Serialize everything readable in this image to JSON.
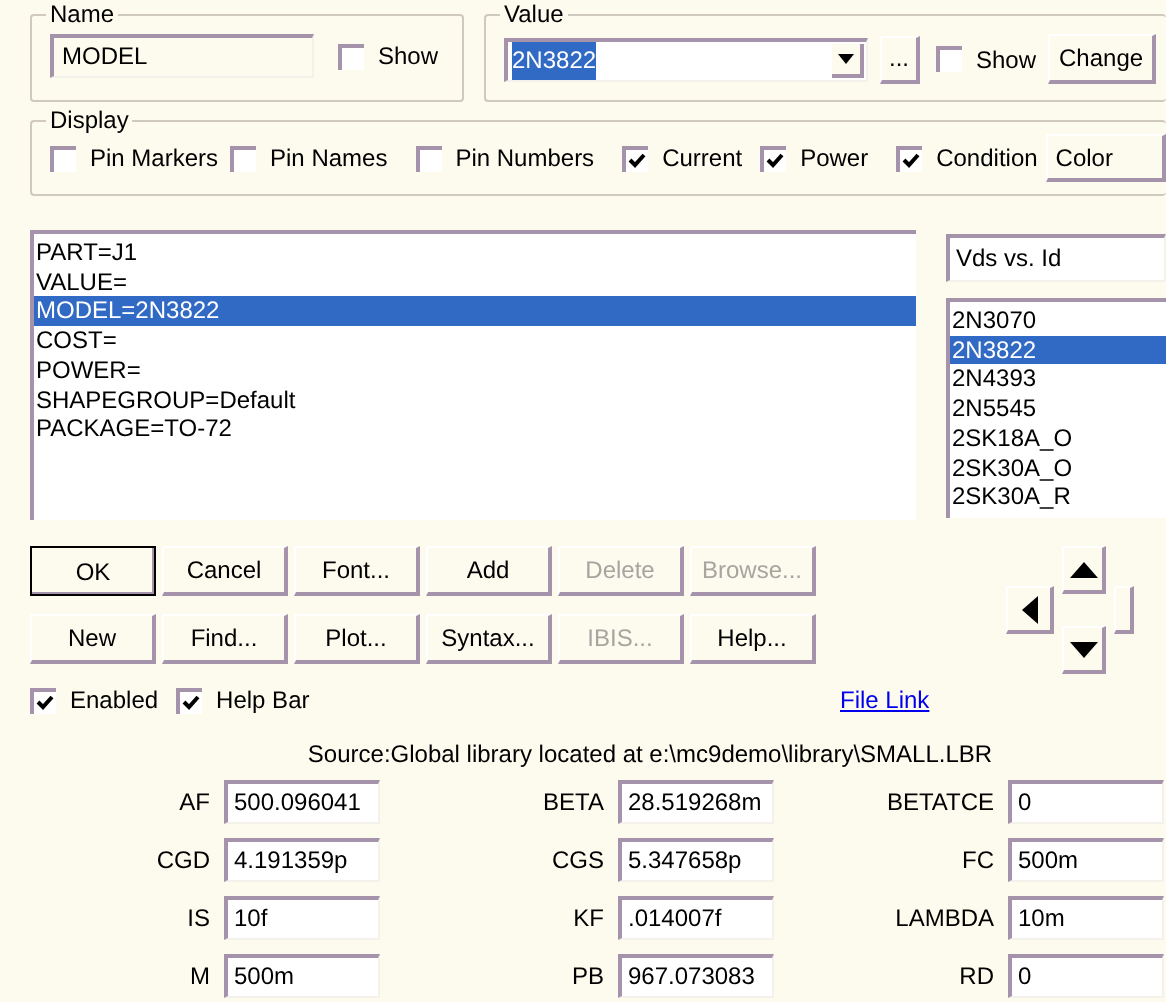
{
  "name_group": {
    "label": "Name",
    "value": "MODEL",
    "show": {
      "label": "Show",
      "checked": false
    }
  },
  "value_group": {
    "label": "Value",
    "value": "2N3822",
    "text_selected": true,
    "browse_button": "...",
    "show": {
      "label": "Show",
      "checked": false
    },
    "change_button": "Change"
  },
  "display": {
    "label": "Display",
    "options": [
      {
        "label": "Pin Markers",
        "checked": false
      },
      {
        "label": "Pin Names",
        "checked": false
      },
      {
        "label": "Pin Numbers",
        "checked": false
      },
      {
        "label": "Current",
        "checked": true
      },
      {
        "label": "Power",
        "checked": true
      },
      {
        "label": "Condition",
        "checked": true
      }
    ],
    "color_button": "Color"
  },
  "attributes": [
    {
      "text": "PART=J1",
      "selected": false
    },
    {
      "text": "VALUE=",
      "selected": false
    },
    {
      "text": "MODEL=2N3822",
      "selected": true
    },
    {
      "text": "COST=",
      "selected": false
    },
    {
      "text": "POWER=",
      "selected": false
    },
    {
      "text": "SHAPEGROUP=Default",
      "selected": false
    },
    {
      "text": "PACKAGE=TO-72",
      "selected": false
    }
  ],
  "plot_combo": "Vds vs. Id",
  "models": [
    {
      "text": "2N3070",
      "selected": false
    },
    {
      "text": "2N3822",
      "selected": true
    },
    {
      "text": "2N4393",
      "selected": false
    },
    {
      "text": "2N5545",
      "selected": false
    },
    {
      "text": "2SK18A_O",
      "selected": false
    },
    {
      "text": "2SK30A_O",
      "selected": false
    },
    {
      "text": "2SK30A_R",
      "selected": false
    }
  ],
  "button_rows": [
    [
      {
        "label": "OK",
        "default": true,
        "disabled": false
      },
      {
        "label": "Cancel",
        "default": false,
        "disabled": false
      },
      {
        "label": "Font...",
        "default": false,
        "disabled": false
      },
      {
        "label": "Add",
        "default": false,
        "disabled": false
      },
      {
        "label": "Delete",
        "default": false,
        "disabled": true
      },
      {
        "label": "Browse...",
        "default": false,
        "disabled": true
      }
    ],
    [
      {
        "label": "New",
        "default": false,
        "disabled": false
      },
      {
        "label": "Find...",
        "default": false,
        "disabled": false
      },
      {
        "label": "Plot...",
        "default": false,
        "disabled": false
      },
      {
        "label": "Syntax...",
        "default": false,
        "disabled": false
      },
      {
        "label": "IBIS...",
        "default": false,
        "disabled": true
      },
      {
        "label": "Help...",
        "default": false,
        "disabled": false
      }
    ]
  ],
  "options": [
    {
      "label": "Enabled",
      "checked": true
    },
    {
      "label": "Help Bar",
      "checked": true
    }
  ],
  "file_link": "File Link",
  "source": "Source:Global library located at e:\\mc9demo\\library\\SMALL.LBR",
  "parameters": [
    {
      "name": "AF",
      "value": "500.096041"
    },
    {
      "name": "BETA",
      "value": "28.519268m"
    },
    {
      "name": "BETATCE",
      "value": "0"
    },
    {
      "name": "CGD",
      "value": "4.191359p"
    },
    {
      "name": "CGS",
      "value": "5.347658p"
    },
    {
      "name": "FC",
      "value": "500m"
    },
    {
      "name": "IS",
      "value": "10f"
    },
    {
      "name": "KF",
      "value": ".014007f"
    },
    {
      "name": "LAMBDA",
      "value": "10m"
    },
    {
      "name": "M",
      "value": "500m"
    },
    {
      "name": "PB",
      "value": "967.073083"
    },
    {
      "name": "RD",
      "value": "0"
    }
  ]
}
